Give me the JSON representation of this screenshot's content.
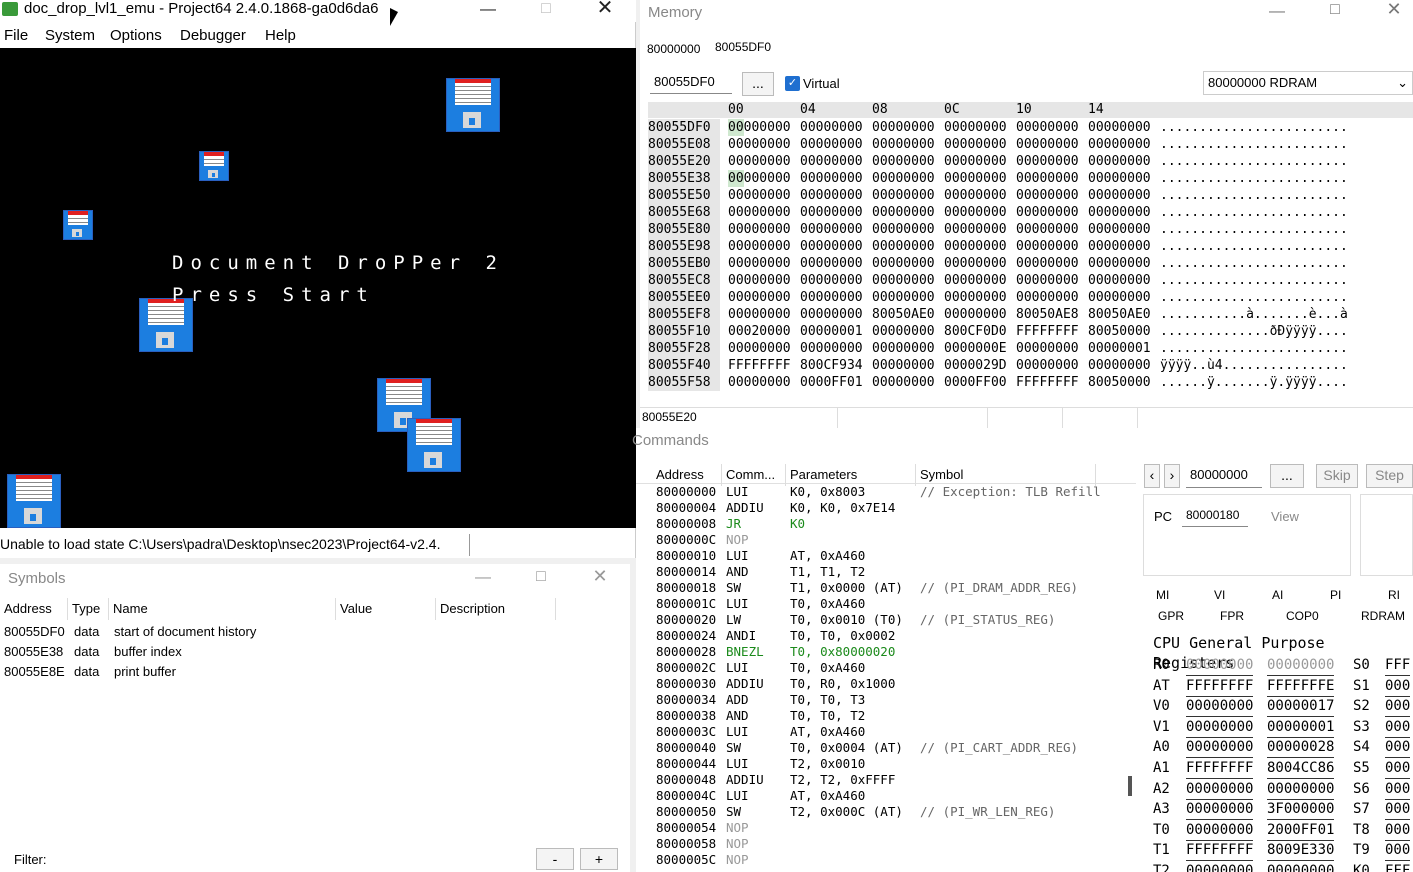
{
  "emulator": {
    "title": "doc_drop_lvl1_emu - Project64 2.4.0.1868-ga0d6da6",
    "menu": [
      "File",
      "System",
      "Options",
      "Debugger",
      "Help"
    ],
    "game_title": "Document DroPPer 2",
    "game_prompt": "Press Start",
    "status": "Unable to load state C:\\Users\\padra\\Desktop\\nsec2023\\Project64-v2.4."
  },
  "symbols": {
    "title": "Symbols",
    "columns": [
      "Address",
      "Type",
      "Name",
      "Value",
      "Description"
    ],
    "rows": [
      {
        "address": "80055DF0",
        "type": "data",
        "name": "start of document history"
      },
      {
        "address": "80055E38",
        "type": "data",
        "name": "buffer index"
      },
      {
        "address": "80055E8E",
        "type": "data",
        "name": "print buffer"
      }
    ],
    "filter_label": "Filter:",
    "minus": "-",
    "plus": "+"
  },
  "memory": {
    "title": "Memory",
    "tab_start": "80000000",
    "tab_current": "80055DF0",
    "address_input": "80055DF0",
    "browse_button": "...",
    "virtual_label": "Virtual",
    "virtual_checked": true,
    "region_select": "80000000 RDRAM",
    "col_headers": [
      "00",
      "04",
      "08",
      "0C",
      "10",
      "14"
    ],
    "rows": [
      {
        "addr": "80055DF0",
        "words": [
          "00000000",
          "00000000",
          "00000000",
          "00000000",
          "00000000",
          "00000000"
        ],
        "ascii": "........................"
      },
      {
        "addr": "80055E08",
        "words": [
          "00000000",
          "00000000",
          "00000000",
          "00000000",
          "00000000",
          "00000000"
        ],
        "ascii": "........................"
      },
      {
        "addr": "80055E20",
        "words": [
          "00000000",
          "00000000",
          "00000000",
          "00000000",
          "00000000",
          "00000000"
        ],
        "ascii": "........................"
      },
      {
        "addr": "80055E38",
        "words": [
          "00000000",
          "00000000",
          "00000000",
          "00000000",
          "00000000",
          "00000000"
        ],
        "ascii": "........................"
      },
      {
        "addr": "80055E50",
        "words": [
          "00000000",
          "00000000",
          "00000000",
          "00000000",
          "00000000",
          "00000000"
        ],
        "ascii": "........................"
      },
      {
        "addr": "80055E68",
        "words": [
          "00000000",
          "00000000",
          "00000000",
          "00000000",
          "00000000",
          "00000000"
        ],
        "ascii": "........................"
      },
      {
        "addr": "80055E80",
        "words": [
          "00000000",
          "00000000",
          "00000000",
          "00000000",
          "00000000",
          "00000000"
        ],
        "ascii": "........................"
      },
      {
        "addr": "80055E98",
        "words": [
          "00000000",
          "00000000",
          "00000000",
          "00000000",
          "00000000",
          "00000000"
        ],
        "ascii": "........................"
      },
      {
        "addr": "80055EB0",
        "words": [
          "00000000",
          "00000000",
          "00000000",
          "00000000",
          "00000000",
          "00000000"
        ],
        "ascii": "........................"
      },
      {
        "addr": "80055EC8",
        "words": [
          "00000000",
          "00000000",
          "00000000",
          "00000000",
          "00000000",
          "00000000"
        ],
        "ascii": "........................"
      },
      {
        "addr": "80055EE0",
        "words": [
          "00000000",
          "00000000",
          "00000000",
          "00000000",
          "00000000",
          "00000000"
        ],
        "ascii": "........................"
      },
      {
        "addr": "80055EF8",
        "words": [
          "00000000",
          "00000000",
          "80050AE0",
          "00000000",
          "80050AE8",
          "80050AE0"
        ],
        "ascii": "...........à.......è...à"
      },
      {
        "addr": "80055F10",
        "words": [
          "00020000",
          "00000001",
          "00000000",
          "800CF0D0",
          "FFFFFFFF",
          "80050000"
        ],
        "ascii": "..............ðÐÿÿÿÿ...."
      },
      {
        "addr": "80055F28",
        "words": [
          "00000000",
          "00000000",
          "00000000",
          "0000000E",
          "00000000",
          "00000001"
        ],
        "ascii": "........................"
      },
      {
        "addr": "80055F40",
        "words": [
          "FFFFFFFF",
          "800CF934",
          "00000000",
          "0000029D",
          "00000000",
          "00000000"
        ],
        "ascii": "ÿÿÿÿ..ù4................"
      },
      {
        "addr": "80055F58",
        "words": [
          "00000000",
          "0000FF01",
          "00000000",
          "0000FF00",
          "FFFFFFFF",
          "80050000"
        ],
        "ascii": "......ÿ.......ÿ.ÿÿÿÿ...."
      }
    ],
    "status_addr": "80055E20"
  },
  "commands": {
    "title": "Commands",
    "columns": [
      "Address",
      "Comm...",
      "Parameters",
      "Symbol"
    ],
    "rows": [
      {
        "a": "80000000",
        "c": "LUI",
        "p": "K0, 0x8003",
        "s": "// Exception: TLB Refill",
        "k": ""
      },
      {
        "a": "80000004",
        "c": "ADDIU",
        "p": "K0, K0, 0x7E14",
        "s": "",
        "k": ""
      },
      {
        "a": "80000008",
        "c": "JR",
        "p": "K0",
        "s": "",
        "k": "green"
      },
      {
        "a": "8000000C",
        "c": "NOP",
        "p": "",
        "s": "",
        "k": "gray"
      },
      {
        "a": "80000010",
        "c": "LUI",
        "p": "AT, 0xA460",
        "s": "",
        "k": ""
      },
      {
        "a": "80000014",
        "c": "AND",
        "p": "T1, T1, T2",
        "s": "",
        "k": ""
      },
      {
        "a": "80000018",
        "c": "SW",
        "p": "T1, 0x0000 (AT)",
        "s": "// (PI_DRAM_ADDR_REG)",
        "k": ""
      },
      {
        "a": "8000001C",
        "c": "LUI",
        "p": "T0, 0xA460",
        "s": "",
        "k": ""
      },
      {
        "a": "80000020",
        "c": "LW",
        "p": "T0, 0x0010 (T0)",
        "s": "// (PI_STATUS_REG)",
        "k": ""
      },
      {
        "a": "80000024",
        "c": "ANDI",
        "p": "T0, T0, 0x0002",
        "s": "",
        "k": ""
      },
      {
        "a": "80000028",
        "c": "BNEZL",
        "p": "T0, 0x80000020",
        "s": "",
        "k": "green"
      },
      {
        "a": "8000002C",
        "c": "LUI",
        "p": "T0, 0xA460",
        "s": "",
        "k": ""
      },
      {
        "a": "80000030",
        "c": "ADDIU",
        "p": "T0, R0, 0x1000",
        "s": "",
        "k": ""
      },
      {
        "a": "80000034",
        "c": "ADD",
        "p": "T0, T0, T3",
        "s": "",
        "k": ""
      },
      {
        "a": "80000038",
        "c": "AND",
        "p": "T0, T0, T2",
        "s": "",
        "k": ""
      },
      {
        "a": "8000003C",
        "c": "LUI",
        "p": "AT, 0xA460",
        "s": "",
        "k": ""
      },
      {
        "a": "80000040",
        "c": "SW",
        "p": "T0, 0x0004 (AT)",
        "s": "// (PI_CART_ADDR_REG)",
        "k": ""
      },
      {
        "a": "80000044",
        "c": "LUI",
        "p": "T2, 0x0010",
        "s": "",
        "k": ""
      },
      {
        "a": "80000048",
        "c": "ADDIU",
        "p": "T2, T2, 0xFFFF",
        "s": "",
        "k": ""
      },
      {
        "a": "8000004C",
        "c": "LUI",
        "p": "AT, 0xA460",
        "s": "",
        "k": ""
      },
      {
        "a": "80000050",
        "c": "SW",
        "p": "T2, 0x000C (AT)",
        "s": "// (PI_WR_LEN_REG)",
        "k": ""
      },
      {
        "a": "80000054",
        "c": "NOP",
        "p": "",
        "s": "",
        "k": "gray"
      },
      {
        "a": "80000058",
        "c": "NOP",
        "p": "",
        "s": "",
        "k": "gray"
      },
      {
        "a": "8000005C",
        "c": "NOP",
        "p": "",
        "s": "",
        "k": "gray"
      }
    ],
    "nav_prev": "‹",
    "nav_next": "›",
    "goto_addr": "80000000",
    "goto_button": "...",
    "skip": "Skip",
    "step": "Step",
    "pc_label": "PC",
    "pc_value": "80000180",
    "view": "View",
    "reg_tabs_top": [
      "MI",
      "VI",
      "AI",
      "PI",
      "RI"
    ],
    "reg_tabs_bottom": [
      "GPR",
      "FPR",
      "COP0",
      "RDRAM"
    ],
    "gpr_title": "CPU General Purpose Registers",
    "registers": [
      {
        "n": "R0",
        "hi": "00000000",
        "lo": "00000000",
        "n2": "S0",
        "v2": "FFF"
      },
      {
        "n": "AT",
        "hi": "FFFFFFFF",
        "lo": "FFFFFFFE",
        "n2": "S1",
        "v2": "000"
      },
      {
        "n": "V0",
        "hi": "00000000",
        "lo": "00000017",
        "n2": "S2",
        "v2": "000"
      },
      {
        "n": "V1",
        "hi": "00000000",
        "lo": "00000001",
        "n2": "S3",
        "v2": "000"
      },
      {
        "n": "A0",
        "hi": "00000000",
        "lo": "00000028",
        "n2": "S4",
        "v2": "000"
      },
      {
        "n": "A1",
        "hi": "FFFFFFFF",
        "lo": "8004CC86",
        "n2": "S5",
        "v2": "000"
      },
      {
        "n": "A2",
        "hi": "00000000",
        "lo": "00000000",
        "n2": "S6",
        "v2": "000"
      },
      {
        "n": "A3",
        "hi": "00000000",
        "lo": "3F000000",
        "n2": "S7",
        "v2": "000"
      },
      {
        "n": "T0",
        "hi": "00000000",
        "lo": "2000FF01",
        "n2": "T8",
        "v2": "000"
      },
      {
        "n": "T1",
        "hi": "FFFFFFFF",
        "lo": "8009E330",
        "n2": "T9",
        "v2": "000"
      },
      {
        "n": "T2",
        "hi": "00000000",
        "lo": "00000000",
        "n2": "K0",
        "v2": "FFF"
      }
    ]
  }
}
